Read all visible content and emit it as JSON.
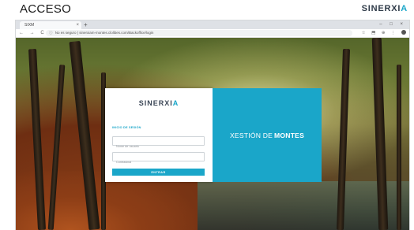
{
  "slide": {
    "title": "ACCESO",
    "brand_main": "SINERXI",
    "brand_accent": "A"
  },
  "browser": {
    "tab_title": "SIXM",
    "tab_close": "×",
    "new_tab": "+",
    "window_controls": "– □ ×",
    "nav_controls": "← → C",
    "security_label": "No es seguro",
    "url": "sinerxiam-montes.clolibes.com/Backoffice/login",
    "extension_icons": "☆ ⬒ ⊕ ⋮"
  },
  "login": {
    "logo_main": "SINERXI",
    "logo_accent": "A",
    "section_label": "INICIO DE SESIÓN",
    "username_placeholder": "Nome de usuario",
    "password_placeholder": "Contrasinal",
    "submit_label": "ENTRAR"
  },
  "promo": {
    "prefix": "XESTIÓN DE",
    "highlight": "MONTES"
  },
  "colors": {
    "accent": "#1aa6c9",
    "brand_dark": "#3b4656"
  }
}
